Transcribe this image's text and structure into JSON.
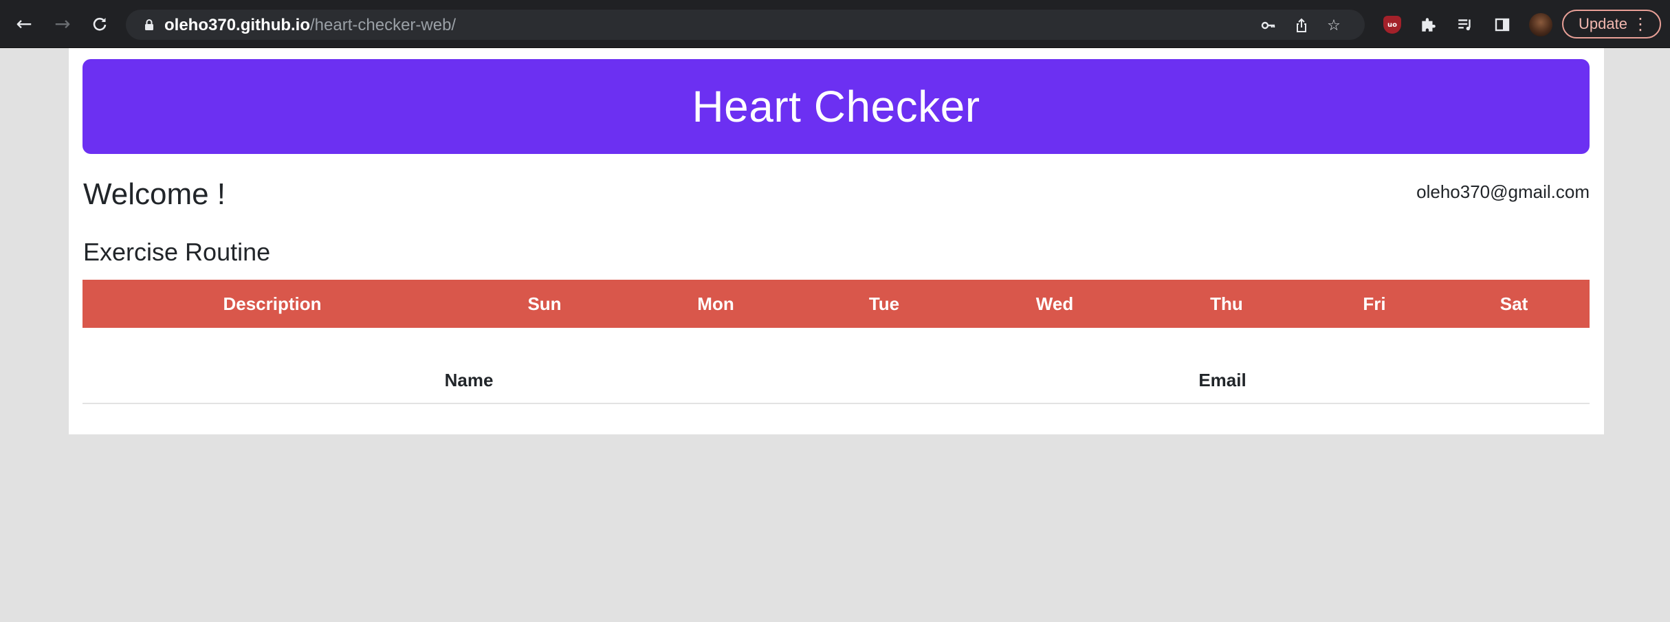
{
  "browser": {
    "back_icon": "arrow-left-icon",
    "forward_icon": "arrow-right-icon",
    "reload_icon": "reload-icon",
    "url_host": "oleho370.github.io",
    "url_path": "/heart-checker-web/",
    "update_label": "Update"
  },
  "header": {
    "title": "Heart Checker",
    "banner_color": "#6c30f2"
  },
  "welcome": {
    "greeting": "Welcome !",
    "email": "oleho370@gmail.com"
  },
  "routine": {
    "title": "Exercise Routine",
    "header_color": "#d9574b",
    "columns": [
      "Description",
      "Sun",
      "Mon",
      "Tue",
      "Wed",
      "Thu",
      "Fri",
      "Sat"
    ]
  },
  "users": {
    "columns": [
      "Name",
      "Email"
    ]
  }
}
